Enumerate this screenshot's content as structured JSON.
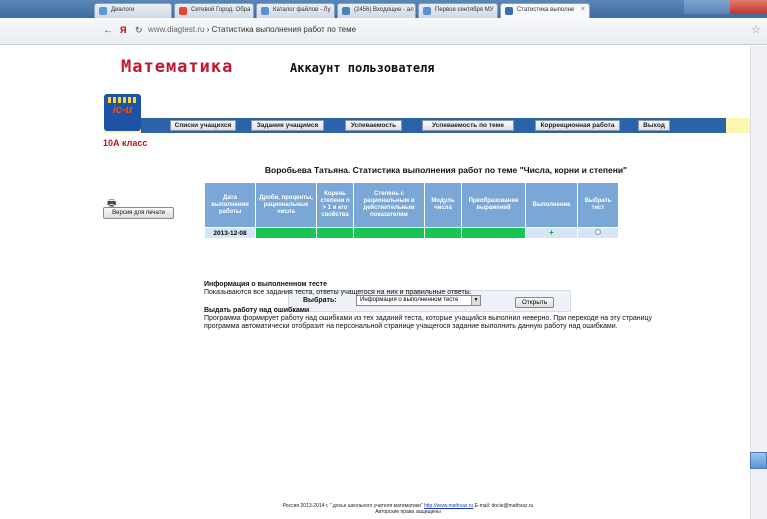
{
  "browser": {
    "tabs": [
      {
        "label": "Диалоги",
        "color": "#5b9bd5"
      },
      {
        "label": "Сетевой Город. Обра",
        "color": "#e8442c"
      },
      {
        "label": "Каталог файлов - Лу",
        "color": "#5a8fd8"
      },
      {
        "label": "(2456) Входящие - ал",
        "color": "#4d7fb8"
      },
      {
        "label": "Первое сентября МУ",
        "color": "#5a8fd8"
      },
      {
        "label": "Статистика выполне",
        "color": "#3a6fb8"
      }
    ],
    "url_host": "www.diagtest.ru",
    "url_separator": "›",
    "url_title": "Статистика выполнения работ по теме"
  },
  "header": {
    "title": "Математика",
    "subtitle": "Аккаунт пользователя",
    "logo_text": "ic-u"
  },
  "menu": {
    "items": [
      "Списки учащихся",
      "Задания учащимся",
      "Успеваемость",
      "Успеваемость по теме",
      "Коррекционная работа",
      "Выход"
    ]
  },
  "class_label": "10А класс",
  "page_heading": "Воробьева Татьяна. Статистика выполнения работ по теме \"Числа, корни и степени\"",
  "print": {
    "button_label": "Версия для печати"
  },
  "table": {
    "headers": [
      "Дата выполнения работы",
      "Дроби, проценты, рациональные числа",
      "Корень степени n > 1 и его свойства",
      "Степень с рациональным и действительным показателем",
      "Модуль числа",
      "Преобразование выражений",
      "Выполнение",
      "Выбрать тест"
    ],
    "rows": [
      {
        "date": "2013-12-08",
        "status": "+"
      }
    ]
  },
  "select_bar": {
    "label": "Выбрать:",
    "value": "Информация о выполненном тесте",
    "open_label": "Открыть"
  },
  "info": {
    "title1": "Информация о выполненном тесте",
    "text1": "Показываются все задания теста, ответы учащегося на них и правильные ответы.",
    "title2": "Выдать работу над ошибками",
    "text2": "Программа формирует работу над ошибками из тех заданий теста, которые учащийся выполнил неверно. При переходе на эту страницу программа автоматически отобразит на персональной странице учащегося задание выполнить данную работу над ошибками."
  },
  "footer": {
    "line1_prefix": "Россия 2013-2014 г. \".досье школьного учителя математики\"",
    "link": "http://www.mathvaz.ru",
    "line1_suffix": "E-mail: docie@mathvaz.ru",
    "line2": "Авторские права защищены"
  }
}
